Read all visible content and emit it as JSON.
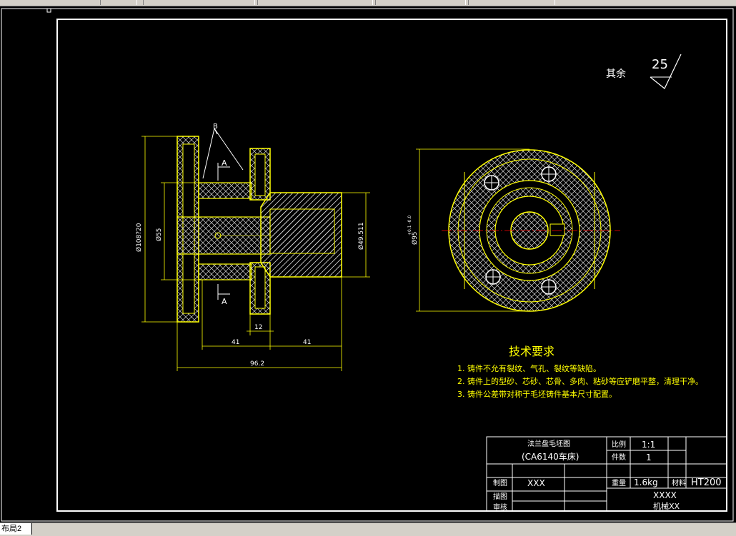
{
  "toolbar": {
    "segments": [
      "",
      "",
      "",
      "",
      ""
    ]
  },
  "layout_tab": {
    "label": "布局2"
  },
  "roughness": {
    "label": "其余",
    "value": "25"
  },
  "dims": {
    "d1": "Ø108?20",
    "d2": "Ø55",
    "d3": "Ø49.511",
    "d4": "Ø95",
    "d4_tol": "+0.1\n-0.0",
    "w12": "12",
    "w41a": "41",
    "w41b": "41",
    "w962": "96.2"
  },
  "marks": {
    "b": "B",
    "a_top": "A",
    "a_bottom": "A"
  },
  "notes": {
    "title": "技术要求",
    "items": [
      "1. 铸件不允有裂纹、气孔、裂纹等缺陷。",
      "2. 铸件上的型砂、芯砂、芯骨、多肉、粘砂等应铲磨平整，清理干净。",
      "3. 铸件公差带对称于毛坯铸件基本尺寸配置。"
    ]
  },
  "title_block": {
    "part_name": "法兰盘毛坯图",
    "model": "(CA6140车床)",
    "scale_label": "比例",
    "scale_value": "1:1",
    "count_label": "件数",
    "count_value": "1",
    "designer_label": "制图",
    "designer_value": "XXX",
    "weight_label": "重量",
    "weight_value": "1.6kg",
    "material_label": "材料",
    "material_value": "HT200",
    "checker_label": "描图",
    "reviewer_label": "审核",
    "school": "XXXX",
    "class": "机械XX"
  },
  "colors": {
    "background": "#000000",
    "outline": "#ffff00",
    "border": "#ffffff",
    "centerline": "#ff0000",
    "accent": "#ffff00"
  }
}
